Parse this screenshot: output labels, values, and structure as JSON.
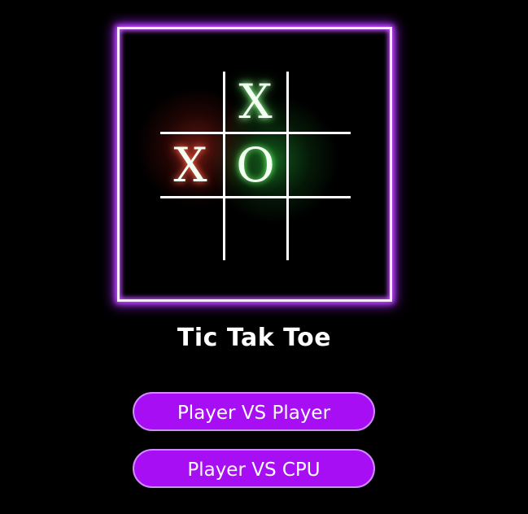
{
  "logo": {
    "board": [
      [
        "",
        "X",
        ""
      ],
      [
        "X",
        "O",
        ""
      ],
      [
        "",
        "",
        ""
      ]
    ],
    "frame_color": "#c04dff"
  },
  "title": "Tic Tak Toe",
  "menu": {
    "pvp_label": "Player VS Player",
    "cpu_label": "Player VS CPU",
    "button_color": "#a80ef3"
  }
}
